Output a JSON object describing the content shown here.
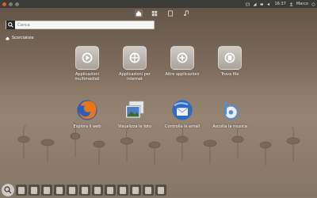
{
  "panel": {
    "time": "16:37",
    "user": "Marco"
  },
  "lenses": [
    {
      "name": "home",
      "label": "Home"
    },
    {
      "name": "applications",
      "label": "Applicazioni"
    },
    {
      "name": "files",
      "label": "File"
    },
    {
      "name": "music",
      "label": "Musica"
    }
  ],
  "search": {
    "placeholder": "Cerca"
  },
  "section": {
    "label": "Scorciatoie"
  },
  "tiles_row1": [
    {
      "label": "Applicazioni multimediali"
    },
    {
      "label": "Applicazioni per internet"
    },
    {
      "label": "Altre applicazioni"
    },
    {
      "label": "Trova file"
    }
  ],
  "tiles_row2": [
    {
      "label": "Esplora il web"
    },
    {
      "label": "Visualizza le foto"
    },
    {
      "label": "Controlla le email"
    },
    {
      "label": "Ascolta la musica"
    }
  ],
  "launcher_count": 12,
  "colors": {
    "panel": "#3c3b37",
    "accent": "#e0592a"
  }
}
